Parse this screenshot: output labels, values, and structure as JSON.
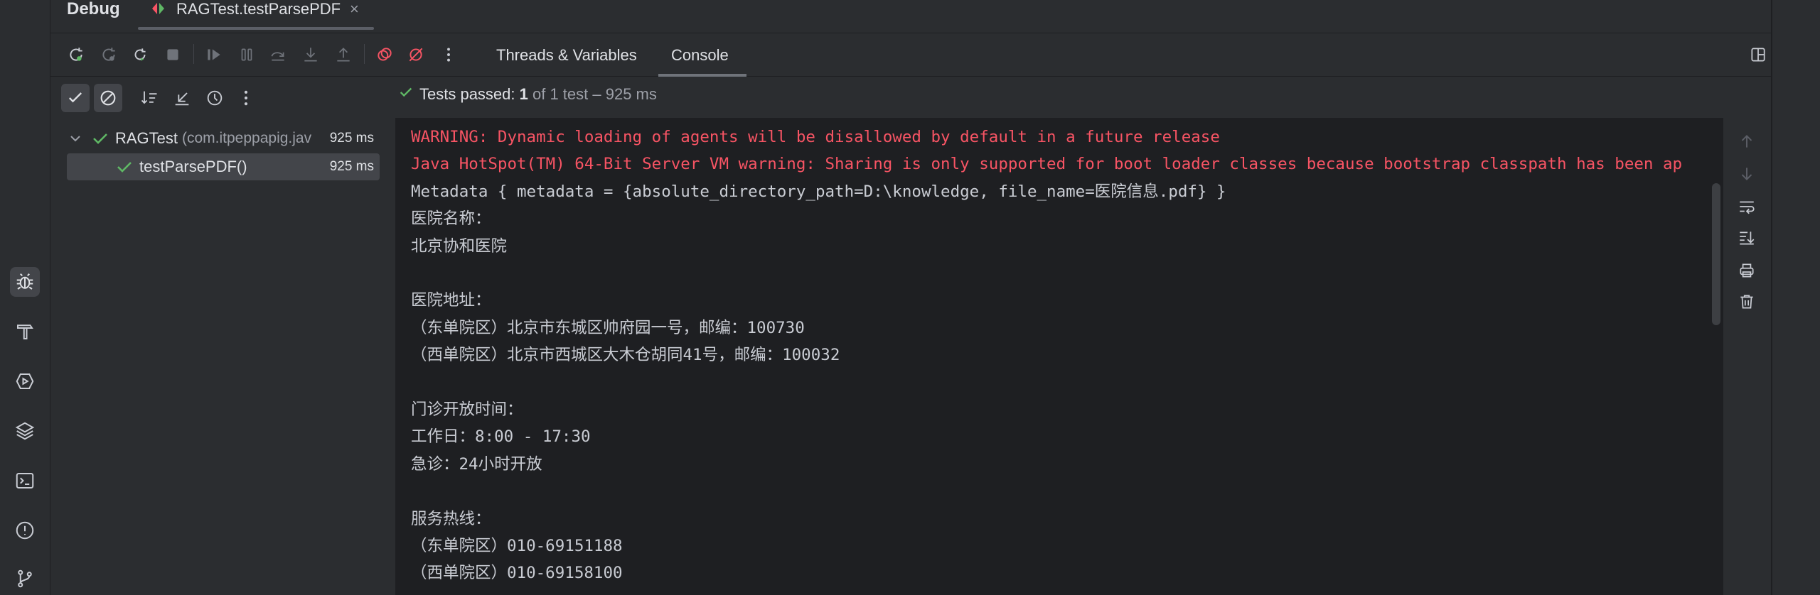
{
  "header": {
    "title": "Debug",
    "session_tab": "RAGTest.testParsePDF",
    "close_glyph": "×"
  },
  "toolbar": {
    "tabs": [
      {
        "label": "Threads & Variables"
      },
      {
        "label": "Console"
      }
    ],
    "icons": [
      "rerun-icon",
      "rerun-failed-icon",
      "rerun-automatically-icon",
      "stop-icon",
      "resume-icon",
      "pause-icon",
      "step-over-icon",
      "step-into-icon",
      "step-out-icon",
      "view-breakpoints-icon",
      "mute-breakpoints-icon",
      "more-icon"
    ]
  },
  "status": {
    "prefix": "Tests passed: ",
    "passed": "1",
    "rest": " of 1 test – 925 ms"
  },
  "tree": {
    "items": [
      {
        "name": "RAGTest",
        "package": " (com.itpeppapig.jav",
        "duration": "925 ms"
      },
      {
        "name": "testParsePDF()",
        "duration": "925 ms"
      }
    ]
  },
  "console": {
    "lines": [
      {
        "type": "err",
        "text": "WARNING: Dynamic loading of agents will be disallowed by default in a future release"
      },
      {
        "type": "err",
        "text": "Java HotSpot(TM) 64-Bit Server VM warning: Sharing is only supported for boot loader classes because bootstrap classpath has been ap"
      },
      {
        "type": "out",
        "text": "Metadata { metadata = {absolute_directory_path=D:\\knowledge, file_name=医院信息.pdf} }"
      },
      {
        "type": "out",
        "text": "医院名称："
      },
      {
        "type": "out",
        "text": "北京协和医院"
      },
      {
        "type": "out",
        "text": ""
      },
      {
        "type": "out",
        "text": "医院地址："
      },
      {
        "type": "out",
        "text": "（东单院区）北京市东城区帅府园一号，邮编：100730"
      },
      {
        "type": "out",
        "text": "（西单院区）北京市西城区大木仓胡同41号，邮编：100032"
      },
      {
        "type": "out",
        "text": ""
      },
      {
        "type": "out",
        "text": "门诊开放时间："
      },
      {
        "type": "out",
        "text": "工作日：8:00 - 17:30"
      },
      {
        "type": "out",
        "text": "急诊：24小时开放"
      },
      {
        "type": "out",
        "text": ""
      },
      {
        "type": "out",
        "text": "服务热线："
      },
      {
        "type": "out",
        "text": "（东单院区）010-69151188"
      },
      {
        "type": "out",
        "text": "（西单院区）010-69158100"
      }
    ]
  },
  "colors": {
    "error": "#f75464",
    "success": "#5fb865",
    "panel": "#2b2d30",
    "console_bg": "#1e1f22"
  }
}
